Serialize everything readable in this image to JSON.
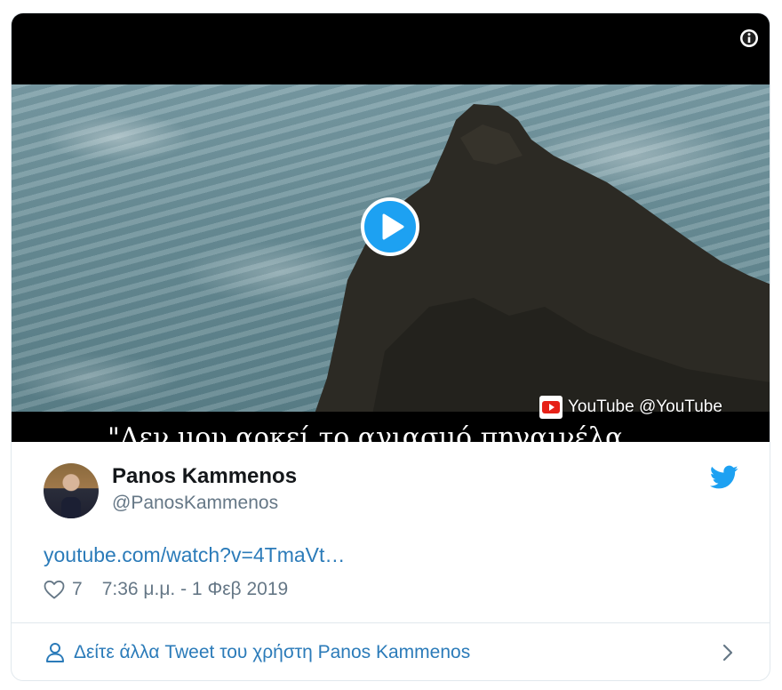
{
  "media": {
    "caption": "\"Δεν μου αρκεί το αγιασμό πηγαινέλα",
    "youtube_badge": "YouTube @YouTube",
    "icons": {
      "info": "info-icon",
      "play": "play-icon",
      "youtube": "youtube-logo-icon"
    }
  },
  "tweet": {
    "display_name": "Panos Kammenos",
    "handle": "@PanosKammenos",
    "link_text": "youtube.com/watch?v=4TmaVt…",
    "like_count": "7",
    "timestamp": "7:36 μ.μ. - 1 Φεβ 2019",
    "icons": {
      "like": "heart-icon",
      "brand": "twitter-bird-icon"
    }
  },
  "footer": {
    "more_tweets_label": "Δείτε άλλα Tweet του χρήστη Panos Kammenos",
    "icons": {
      "person": "person-icon",
      "chevron": "chevron-right-icon"
    }
  },
  "colors": {
    "accent": "#1da1f2",
    "link": "#2b7bb9",
    "muted": "#657786",
    "youtube_red": "#e62117"
  }
}
